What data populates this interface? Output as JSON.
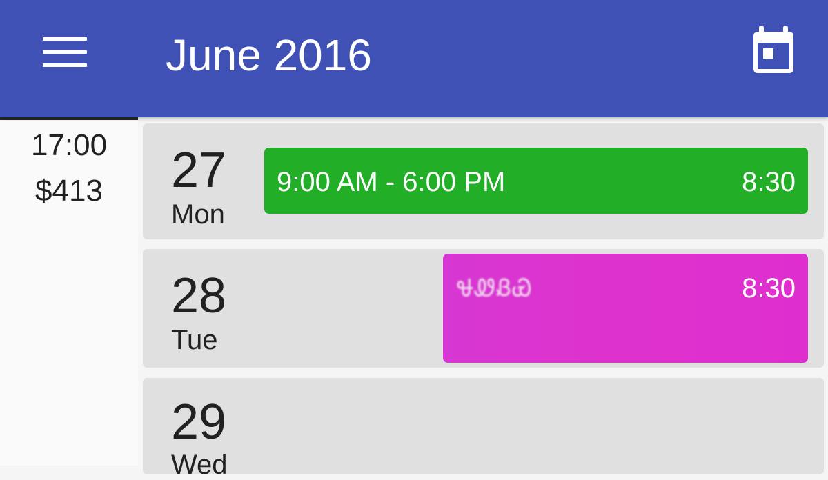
{
  "appbar": {
    "title": "June 2016",
    "menu_icon": "menu-icon",
    "calendar_icon": "calendar-today-icon",
    "color": "#3f51b5"
  },
  "sidebar": {
    "hours": "17:00",
    "pay": "$413"
  },
  "days": [
    {
      "number": "27",
      "weekday": "Mon",
      "event": {
        "time_range": "9:00 AM - 6:00 PM",
        "duration": "8:30",
        "color": "#23ae27"
      }
    },
    {
      "number": "28",
      "weekday": "Tue",
      "event": {
        "label": "ᏠᏪᏰᏯ",
        "duration": "8:30",
        "color": "#dd33ce"
      }
    },
    {
      "number": "29",
      "weekday": "Wed"
    }
  ]
}
